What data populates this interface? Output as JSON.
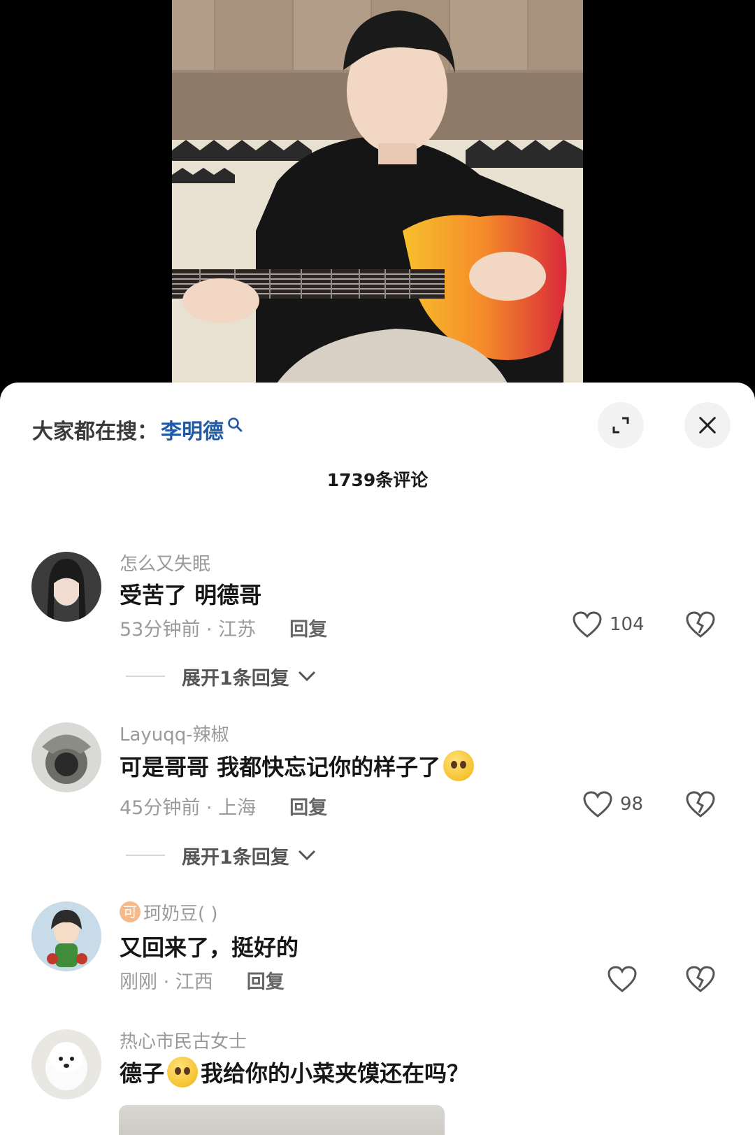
{
  "search": {
    "prefix": "大家都在搜：",
    "keyword": "李明德"
  },
  "header": {
    "comment_count": "1739条评论"
  },
  "comments": [
    {
      "username": "怎么又失眠",
      "text": "受苦了 明德哥",
      "time_location": "53分钟前 · 江苏",
      "reply_label": "回复",
      "likes": "104",
      "expand_replies": "展开1条回复"
    },
    {
      "username": "Layuqq-辣椒",
      "text": "可是哥哥 我都快忘记你的样子了",
      "time_location": "45分钟前 · 上海",
      "reply_label": "回复",
      "likes": "98",
      "expand_replies": "展开1条回复"
    },
    {
      "badge": "可",
      "username": "珂奶豆( )",
      "text": "又回来了，挺好的",
      "time_location": "刚刚 · 江西",
      "reply_label": "回复",
      "likes": ""
    },
    {
      "username": "热心市民古女士",
      "text_a": "德子",
      "text_b": "我给你的小菜夹馍还在吗？"
    }
  ],
  "icons": {
    "search": "search-icon",
    "expand": "expand-icon",
    "close": "close-icon",
    "like": "heart-icon",
    "dislike": "broken-heart-icon",
    "chevron": "chevron-down-icon"
  },
  "colors": {
    "keyword": "#1f5aa6",
    "muted": "#9a9a9a"
  }
}
